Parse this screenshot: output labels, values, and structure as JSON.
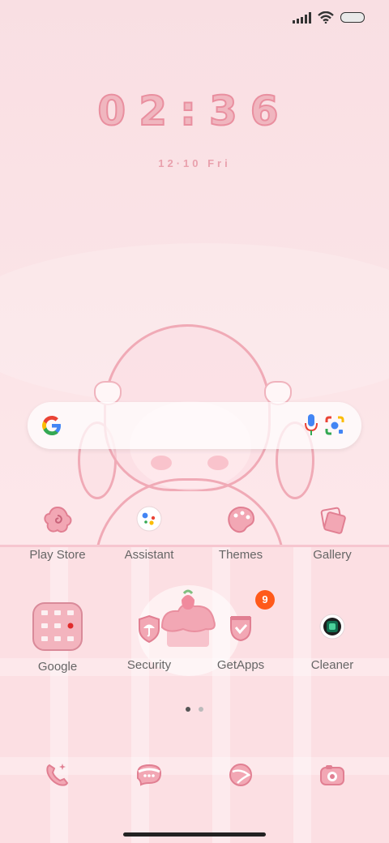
{
  "status_bar": {
    "icons": [
      "signal-icon",
      "wifi-icon",
      "battery-icon"
    ]
  },
  "clock": {
    "time": "02:36",
    "date": "12·10 Fri"
  },
  "search": {
    "icons": [
      "google-logo-icon",
      "mic-icon",
      "lens-icon"
    ]
  },
  "apps_row1": [
    {
      "label": "Play Store",
      "icon": "flower-swirl-icon"
    },
    {
      "label": "Assistant",
      "icon": "assistant-icon"
    },
    {
      "label": "Themes",
      "icon": "palette-icon"
    },
    {
      "label": "Gallery",
      "icon": "photos-icon"
    }
  ],
  "apps_row2": [
    {
      "label": "Google",
      "icon": "folder-icon"
    },
    {
      "label": "Security",
      "icon": "shield-umbrella-icon"
    },
    {
      "label": "GetApps",
      "icon": "getapps-icon",
      "badge": "9"
    },
    {
      "label": "Cleaner",
      "icon": "cleaner-icon"
    }
  ],
  "page_indicator": {
    "pages": 2,
    "active": 1
  },
  "dock": [
    {
      "icon": "phone-icon"
    },
    {
      "icon": "messages-icon"
    },
    {
      "icon": "browser-icon"
    },
    {
      "icon": "camera-icon"
    }
  ],
  "colors": {
    "accent": "#e98f9f",
    "badge": "#ff5a1a",
    "label": "#666666"
  }
}
